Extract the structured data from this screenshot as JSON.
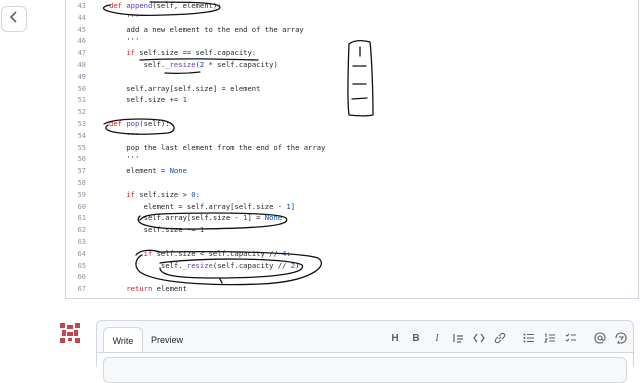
{
  "code": {
    "lines": [
      {
        "num": "43",
        "tokens": [
          {
            "t": "def ",
            "c": "kw"
          },
          {
            "t": "append",
            "c": "fn"
          },
          {
            "t": "(self, element):",
            "c": ""
          }
        ]
      },
      {
        "num": "44",
        "tokens": [
          {
            "t": "    '''",
            "c": ""
          }
        ]
      },
      {
        "num": "45",
        "tokens": [
          {
            "t": "    add a new element to the end of the array",
            "c": ""
          }
        ]
      },
      {
        "num": "46",
        "tokens": [
          {
            "t": "    '''",
            "c": ""
          }
        ]
      },
      {
        "num": "47",
        "tokens": [
          {
            "t": "    ",
            "c": ""
          },
          {
            "t": "if",
            "c": "kw"
          },
          {
            "t": " self.size == self.capacity:",
            "c": ""
          }
        ]
      },
      {
        "num": "48",
        "tokens": [
          {
            "t": "        self.",
            "c": ""
          },
          {
            "t": "_resize",
            "c": "fn"
          },
          {
            "t": "(",
            "c": ""
          },
          {
            "t": "2",
            "c": "num"
          },
          {
            "t": " * self.capacity)",
            "c": ""
          }
        ]
      },
      {
        "num": "49",
        "tokens": []
      },
      {
        "num": "50",
        "tokens": [
          {
            "t": "    self.array[self.size] = element",
            "c": ""
          }
        ]
      },
      {
        "num": "51",
        "tokens": [
          {
            "t": "    self.size += ",
            "c": ""
          },
          {
            "t": "1",
            "c": "num"
          }
        ]
      },
      {
        "num": "52",
        "tokens": []
      },
      {
        "num": "53",
        "tokens": [
          {
            "t": "def ",
            "c": "kw"
          },
          {
            "t": "pop",
            "c": "fn"
          },
          {
            "t": "(self):",
            "c": ""
          }
        ]
      },
      {
        "num": "54",
        "tokens": [
          {
            "t": "    '''",
            "c": ""
          }
        ]
      },
      {
        "num": "55",
        "tokens": [
          {
            "t": "    pop the last element from the end of the array",
            "c": ""
          }
        ]
      },
      {
        "num": "56",
        "tokens": [
          {
            "t": "    '''",
            "c": ""
          }
        ]
      },
      {
        "num": "57",
        "tokens": [
          {
            "t": "    element = ",
            "c": ""
          },
          {
            "t": "None",
            "c": "const"
          }
        ]
      },
      {
        "num": "58",
        "tokens": []
      },
      {
        "num": "59",
        "tokens": [
          {
            "t": "    ",
            "c": ""
          },
          {
            "t": "if",
            "c": "kw"
          },
          {
            "t": " self.size > ",
            "c": ""
          },
          {
            "t": "0",
            "c": "num"
          },
          {
            "t": ":",
            "c": ""
          }
        ]
      },
      {
        "num": "60",
        "tokens": [
          {
            "t": "        element = self.array[self.size - ",
            "c": ""
          },
          {
            "t": "1",
            "c": "num"
          },
          {
            "t": "]",
            "c": ""
          }
        ]
      },
      {
        "num": "61",
        "tokens": [
          {
            "t": "        self.array[self.size - ",
            "c": ""
          },
          {
            "t": "1",
            "c": "num"
          },
          {
            "t": "] = ",
            "c": ""
          },
          {
            "t": "None",
            "c": "const"
          }
        ]
      },
      {
        "num": "62",
        "tokens": [
          {
            "t": "        self.size -= ",
            "c": ""
          },
          {
            "t": "1",
            "c": "num"
          }
        ]
      },
      {
        "num": "63",
        "tokens": []
      },
      {
        "num": "64",
        "tokens": [
          {
            "t": "        ",
            "c": ""
          },
          {
            "t": "if",
            "c": "kw"
          },
          {
            "t": " self.size < self.capacity // ",
            "c": ""
          },
          {
            "t": "4",
            "c": "num"
          },
          {
            "t": ":",
            "c": ""
          }
        ]
      },
      {
        "num": "65",
        "tokens": [
          {
            "t": "            self.",
            "c": ""
          },
          {
            "t": "_resize",
            "c": "fn"
          },
          {
            "t": "(self.capacity // ",
            "c": ""
          },
          {
            "t": "2",
            "c": "num"
          },
          {
            "t": ")",
            "c": ""
          }
        ]
      },
      {
        "num": "66",
        "tokens": []
      },
      {
        "num": "67",
        "tokens": [
          {
            "t": "    ",
            "c": ""
          },
          {
            "t": "return",
            "c": "kw"
          },
          {
            "t": " element",
            "c": ""
          }
        ]
      }
    ]
  },
  "comment": {
    "tabs": {
      "write": "Write",
      "preview": "Preview"
    },
    "toolbar": {
      "heading": "H",
      "bold": "B",
      "italic": "I"
    }
  },
  "colors": {
    "keyword": "#cf222e",
    "function": "#6639ba",
    "number": "#0550ae",
    "ink": "#111111"
  },
  "icons": [
    "chevron-left-icon",
    "heading-icon",
    "bold-icon",
    "italic-icon",
    "quote-icon",
    "code-icon",
    "link-icon",
    "bulleted-list-icon",
    "numbered-list-icon",
    "task-list-icon",
    "mention-icon",
    "reference-icon"
  ]
}
